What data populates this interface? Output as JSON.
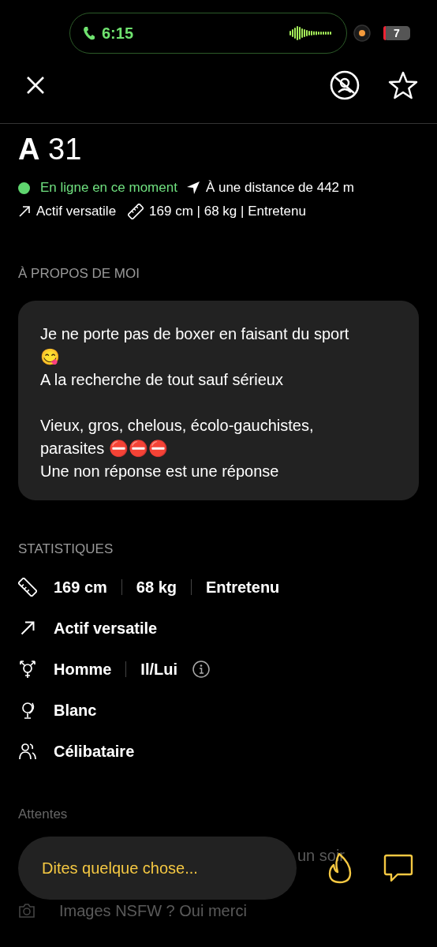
{
  "status_bar": {
    "call_time": "6:15",
    "battery": "7"
  },
  "profile": {
    "name": "A",
    "age": "31",
    "online": true,
    "online_text": "En ligne en ce moment",
    "distance": "À une distance de 442 m",
    "position": "Actif versatile",
    "body": "169 cm | 68 kg | Entretenu"
  },
  "about": {
    "heading": "À PROPOS DE MOI",
    "paragraphs": [
      [
        "Je ne porte pas de boxer en faisant du sport 😋",
        "A la recherche de tout sauf sérieux"
      ],
      [
        "Vieux, gros, chelous, écolo-gauchistes, parasites ⛔⛔⛔",
        "Une non réponse est une réponse"
      ]
    ]
  },
  "stats": {
    "heading": "STATISTIQUES",
    "rows": [
      {
        "kind": "ruler",
        "values": [
          {
            "kind": "text",
            "text": "169 cm"
          },
          {
            "kind": "text",
            "text": "68 kg"
          },
          {
            "kind": "text",
            "text": "Entretenu"
          }
        ]
      },
      {
        "kind": "arrow",
        "values": [
          {
            "kind": "text",
            "text": "Actif versatile"
          }
        ]
      },
      {
        "kind": "gender",
        "values": [
          {
            "kind": "text",
            "text": "Homme"
          },
          {
            "kind": "text",
            "text": "Il/Lui"
          },
          {
            "kind": "info"
          }
        ]
      },
      {
        "kind": "globe",
        "values": [
          {
            "kind": "text",
            "text": "Blanc"
          }
        ]
      },
      {
        "kind": "people",
        "values": [
          {
            "kind": "text",
            "text": "Célibataire"
          }
        ]
      }
    ]
  },
  "expectations": {
    "heading": "Attentes",
    "rows": [
      {
        "kind": "covered",
        "text": "un soir"
      },
      {
        "kind": "camera",
        "text": "Images NSFW ? Oui merci"
      }
    ]
  },
  "composer": {
    "placeholder": "Dites quelque chose..."
  }
}
